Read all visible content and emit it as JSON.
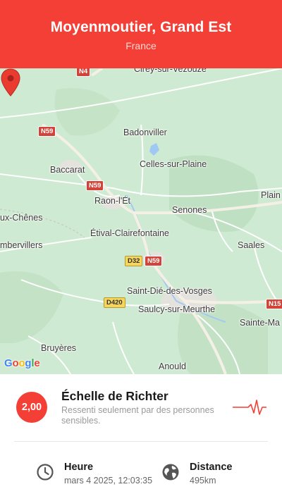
{
  "header": {
    "title": "Moyenmoutier, Grand Est",
    "subtitle": "France"
  },
  "map": {
    "places": [
      "Cirey-sur-Vezouze",
      "Badonviller",
      "Baccarat",
      "Celles-sur-Plaine",
      "Raon-l'Ét",
      "Senones",
      "Plain",
      "ux-Chênes",
      "Étival-Clairefontaine",
      "Saales",
      "mbervillers",
      "Saint-Dié-des-Vosges",
      "Sainte-Ma",
      "Saulcy-sur-Meurthe",
      "Bruyères",
      "Anould"
    ],
    "roads": [
      "N4",
      "N59",
      "N59",
      "D32",
      "N59",
      "D420",
      "N15"
    ],
    "logo_letters": [
      "G",
      "o",
      "o",
      "g",
      "l",
      "e"
    ],
    "marker_icon": "location-pin-icon"
  },
  "quake": {
    "magnitude": "2,00",
    "scale_title": "Échelle de Richter",
    "description": "Ressenti seulement par des personnes sensibles.",
    "wave_icon": "seismograph-icon"
  },
  "details": {
    "time_label": "Heure",
    "time_value": "mars 4 2025, 12:03:35",
    "time_icon": "clock-icon",
    "distance_label": "Distance",
    "distance_value": "495km",
    "distance_icon": "globe-icon"
  },
  "colors": {
    "accent": "#f33f35",
    "map_land": "#cfead2",
    "map_road": "#ffffff"
  }
}
